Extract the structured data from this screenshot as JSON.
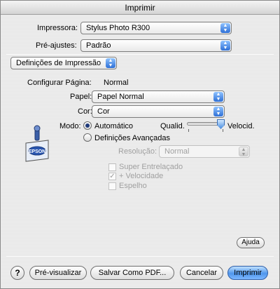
{
  "window": {
    "title": "Imprimir"
  },
  "printer": {
    "label": "Impressora:",
    "value": "Stylus Photo R300"
  },
  "presets": {
    "label": "Pré-ajustes:",
    "value": "Padrão"
  },
  "panel": {
    "value": "Definições de Impressão"
  },
  "page_setup": {
    "label": "Configurar Página:",
    "value": "Normal"
  },
  "paper": {
    "label": "Papel:",
    "value": "Papel Normal"
  },
  "color": {
    "label": "Cor:",
    "value": "Cor"
  },
  "mode": {
    "label": "Modo:",
    "options": [
      {
        "label": "Automático",
        "selected": true
      },
      {
        "label": "Definições Avançadas",
        "selected": false
      }
    ],
    "quality_label": "Qualid.",
    "speed_label": "Velocid.",
    "quality_speed_level": 1.0
  },
  "resolution": {
    "label": "Resolução:",
    "value": "Normal",
    "enabled": false
  },
  "advanced_checks": [
    {
      "label": "Super Entrelaçado",
      "checked": false,
      "enabled": false
    },
    {
      "label": "+ Velocidade",
      "checked": true,
      "enabled": false
    },
    {
      "label": "Espelho",
      "checked": false,
      "enabled": false
    }
  ],
  "logo": {
    "text": "EPSON",
    "icon": "epson-printer-icon"
  },
  "buttons": {
    "help_small": "Ajuda",
    "help_icon": "?",
    "preview": "Pré-visualizar",
    "save_pdf": "Salvar Como PDF...",
    "cancel": "Cancelar",
    "print": "Imprimir"
  },
  "colors": {
    "accent": "#2d6fd6",
    "default_button": "#4f96ec"
  }
}
